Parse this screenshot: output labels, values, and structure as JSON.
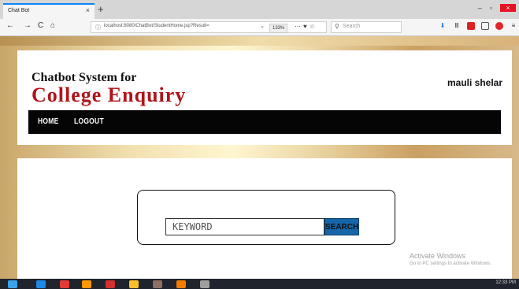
{
  "browser": {
    "tab_title": "Chat Bot",
    "tab_close": "×",
    "new_tab": "+",
    "back": "←",
    "forward": "→",
    "reload": "C",
    "home": "⌂",
    "url": "localhost:8080/ChatBot/StudentHome.jsp?Result=",
    "zoom": "133%",
    "search_placeholder": "Search",
    "window_min": "–",
    "window_max": "▫",
    "window_close": "×"
  },
  "header": {
    "title_line1": "Chatbot System for",
    "title_line2": "College Enquiry",
    "username": "mauli shelar"
  },
  "menu": {
    "items": [
      "HOME",
      "LOGOUT"
    ]
  },
  "search": {
    "placeholder": "KEYWORD",
    "button_label": "SEARCH"
  },
  "watermark": {
    "line1": "Activate Windows",
    "line2": "Go to PC settings to activate Windows."
  },
  "taskbar": {
    "clock": "12:33 PM"
  },
  "colors": {
    "title_red": "#b0141a",
    "menu_bg": "#050505",
    "button_blue": "#1565a8"
  }
}
